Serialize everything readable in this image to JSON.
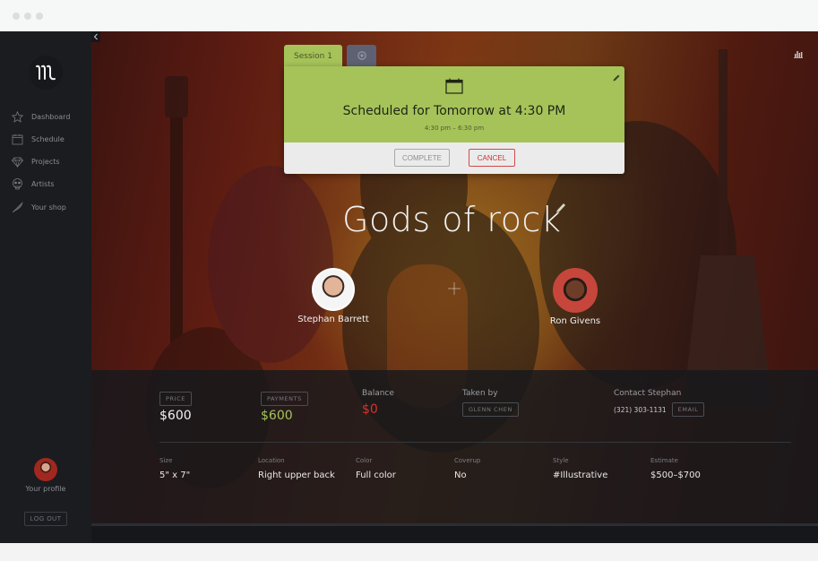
{
  "sidebar": {
    "logo_icon": "brand-logo-icon",
    "items": [
      {
        "label": "Dashboard",
        "icon": "star-icon"
      },
      {
        "label": "Schedule",
        "icon": "calendar-icon"
      },
      {
        "label": "Projects",
        "icon": "diamond-icon"
      },
      {
        "label": "Artists",
        "icon": "skull-icon"
      },
      {
        "label": "Your shop",
        "icon": "feather-icon"
      }
    ],
    "profile_label": "Your profile",
    "logout_label": "LOG OUT"
  },
  "session": {
    "tab_label": "Session 1",
    "add_tab_icon": "plus-circle-icon",
    "title": "Scheduled for Tomorrow at 4:30 PM",
    "time_range": "4:30 pm – 6:30 pm",
    "complete_label": "COMPLETE",
    "cancel_label": "CANCEL",
    "accent_color": "#a6c35a"
  },
  "project": {
    "title": "Gods of rock",
    "people": [
      {
        "name": "Stephan Barrett"
      },
      {
        "name": "Ron Givens"
      }
    ]
  },
  "billing": {
    "price_label": "PRICE",
    "price_value": "$600",
    "payments_label": "PAYMENTS",
    "payments_value": "$600",
    "balance_label": "Balance",
    "balance_value": "$0",
    "taken_by_label": "Taken by",
    "taken_by_value": "GLENN CHEN",
    "contact_label": "Contact Stephan",
    "contact_phone": "(321) 303-1131",
    "email_label": "EMAIL",
    "payments_color": "#a6c35a",
    "balance_color": "#d8322a"
  },
  "details": [
    {
      "label": "Size",
      "value": "5\" x 7\""
    },
    {
      "label": "Location",
      "value": "Right upper back"
    },
    {
      "label": "Color",
      "value": "Full color"
    },
    {
      "label": "Coverup",
      "value": "No"
    },
    {
      "label": "Style",
      "value": "#Illustrative"
    },
    {
      "label": "Estimate",
      "value": "$500–$700"
    }
  ]
}
